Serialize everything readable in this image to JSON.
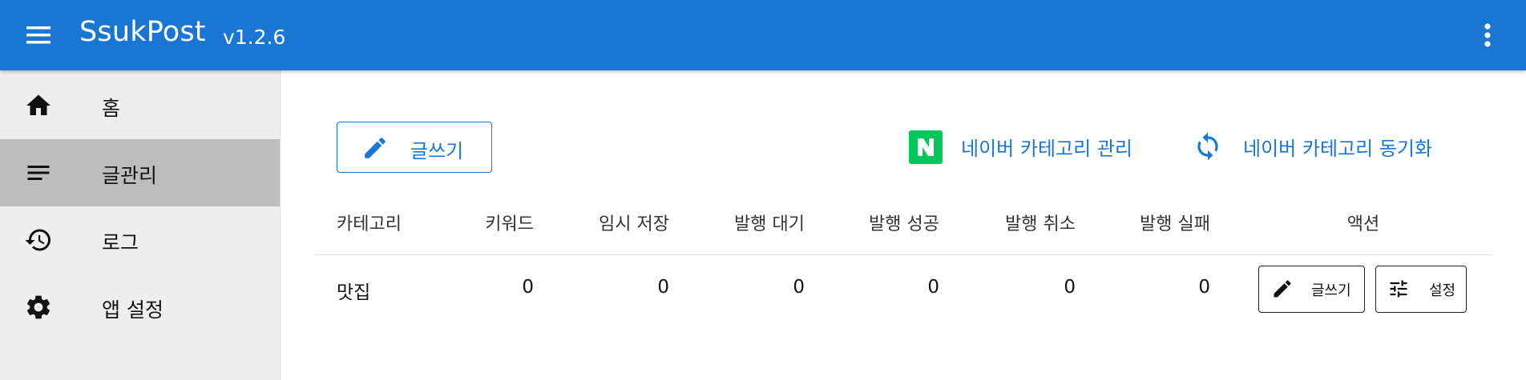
{
  "app": {
    "title": "SsukPost",
    "version": "v1.2.6",
    "brand_color": "#1976d2"
  },
  "sidebar": {
    "items": [
      {
        "label": "홈",
        "icon": "home-icon",
        "active": false
      },
      {
        "label": "글관리",
        "icon": "list-icon",
        "active": true
      },
      {
        "label": "로그",
        "icon": "history-icon",
        "active": false
      },
      {
        "label": "앱 설정",
        "icon": "gear-icon",
        "active": false
      }
    ]
  },
  "toolbar": {
    "write_label": "글쓰기",
    "naver_manage_label": "네이버 카테고리 관리",
    "naver_sync_label": "네이버 카테고리 동기화",
    "naver_color": "#03c75a"
  },
  "table": {
    "headers": [
      "카테고리",
      "키워드",
      "임시 저장",
      "발행 대기",
      "발행 성공",
      "발행 취소",
      "발행 실패",
      "액션"
    ],
    "rows": [
      {
        "category": "맛집",
        "keyword": "0",
        "draft": "0",
        "pending": "0",
        "published": "0",
        "cancelled": "0",
        "failed": "0",
        "actions": {
          "write_label": "글쓰기",
          "settings_label": "설정"
        }
      }
    ]
  }
}
